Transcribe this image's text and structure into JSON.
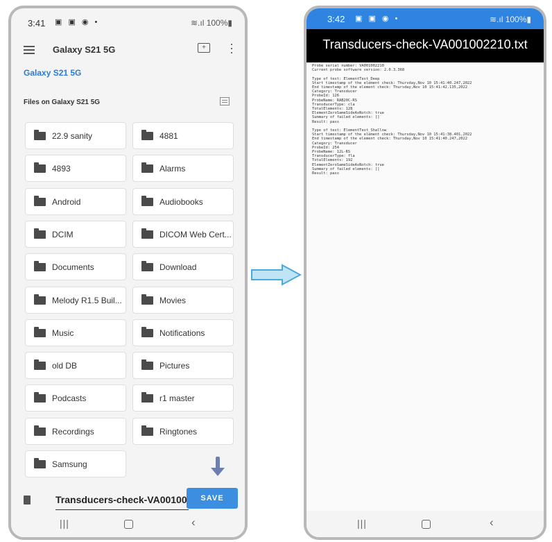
{
  "left": {
    "status": {
      "time": "3:41",
      "icons": "▣ ▣ ◉ •",
      "right": "≋.ıl 100%▮"
    },
    "appbar": {
      "title": "Galaxy S21 5G",
      "new_folder_icon": "create-folder-icon",
      "overflow_icon": "more-vert-icon"
    },
    "breadcrumb": "Galaxy S21 5G",
    "section_label": "Files on Galaxy S21 5G",
    "folders": [
      "22.9 sanity",
      "4881",
      "4893",
      "Alarms",
      "Android",
      "Audiobooks",
      "DCIM",
      "DICOM Web Cert...",
      "Documents",
      "Download",
      "Melody R1.5 Buil...",
      "Movies",
      "Music",
      "Notifications",
      "old DB",
      "Pictures",
      "Podcasts",
      "r1 master",
      "Recordings",
      "Ringtones",
      "Samsung"
    ],
    "savebar": {
      "filename": "Transducers-check-VA00100",
      "save_label": "SAVE"
    },
    "nav": {
      "recent": "|||",
      "home": "",
      "back": "‹"
    }
  },
  "right": {
    "status": {
      "time": "3:42",
      "icons": "▣ ▣ ◉ •",
      "right": "≋.ıl 100%▮"
    },
    "title": "Transducers-check-VA001002210.txt",
    "content": "Probe serial number: VA001002210\nCurrent probe software version: 2.0.3.368\n\nType of test: ElementTest_Deep\nStart timestamp of the element check: Thursday,Nov 10 15:41:40.247,2022\nEnd timestamp of the element check: Thursday,Nov 10 15:41:42.135,2022\nCategory: Transducer\nProbeId: 126\nProbeName: RAB20C-RS\nTransducerType: cla\nTotalElements: 128\nElementZeroSameSideAsNotch: true\nSummary of failed elements: []\nResult: pass\n\nType of test: ElementTest_Shallow\nStart timestamp of the element check: Thursday,Nov 10 15:41:38.401,2022\nEnd timestamp of the element check: Thursday,Nov 10 15:41:40.247,2022\nCategory: Transducer\nProbeId: 254\nProbeName: 12L-RS\nTransducerType: fla\nTotalElements: 192\nElementZeroSameSideAsNotch: true\nSummary of failed elements: []\nResult: pass",
    "nav": {
      "recent": "|||",
      "home": "",
      "back": "‹"
    }
  },
  "colors": {
    "accent": "#3b8ee0",
    "arrow": "#4aa9d8",
    "down_arrow": "#6c7fb0"
  }
}
